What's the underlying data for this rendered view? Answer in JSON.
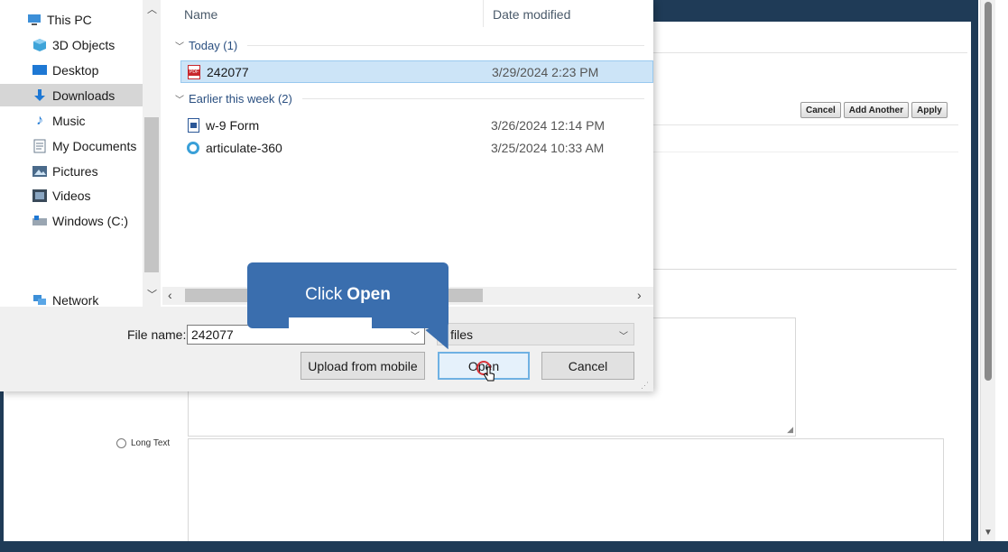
{
  "nav": {
    "items": [
      {
        "label": "This PC",
        "icon": "pc-icon"
      },
      {
        "label": "3D Objects",
        "icon": "cube-icon"
      },
      {
        "label": "Desktop",
        "icon": "desktop-icon"
      },
      {
        "label": "Downloads",
        "icon": "download-arrow-icon",
        "selected": true
      },
      {
        "label": "Music",
        "icon": "music-note-icon"
      },
      {
        "label": "My Documents",
        "icon": "documents-icon"
      },
      {
        "label": "Pictures",
        "icon": "pictures-icon"
      },
      {
        "label": "Videos",
        "icon": "videos-icon"
      },
      {
        "label": "Windows (C:)",
        "icon": "drive-icon"
      },
      {
        "label": "Network",
        "icon": "network-icon"
      }
    ]
  },
  "file_list": {
    "columns": {
      "name": "Name",
      "date": "Date modified"
    },
    "groups": [
      {
        "label": "Today (1)",
        "files": [
          {
            "name": "242077",
            "date": "3/29/2024 2:23 PM",
            "icon": "pdf-icon",
            "selected": true
          }
        ]
      },
      {
        "label": "Earlier this week (2)",
        "files": [
          {
            "name": "w-9 Form",
            "date": "3/26/2024 12:14 PM",
            "icon": "document-icon"
          },
          {
            "name": "articulate-360",
            "date": "3/25/2024 10:33 AM",
            "icon": "app-icon"
          }
        ]
      }
    ]
  },
  "bottom": {
    "file_name_label": "File name:",
    "file_name_value": "242077",
    "file_type_value": "ll files",
    "upload_label": "Upload from mobile",
    "open_label": "Open",
    "cancel_label": "Cancel"
  },
  "callout": {
    "prefix": "Click",
    "emphasis": "Open"
  },
  "page_actions": {
    "cancel": "Cancel",
    "add_another": "Add Another",
    "apply": "Apply"
  },
  "page_form": {
    "long_text_label": "Long Text"
  },
  "colors": {
    "accent": "#3a6eae",
    "header": "#1f3b57",
    "selection": "#cce4f7"
  }
}
